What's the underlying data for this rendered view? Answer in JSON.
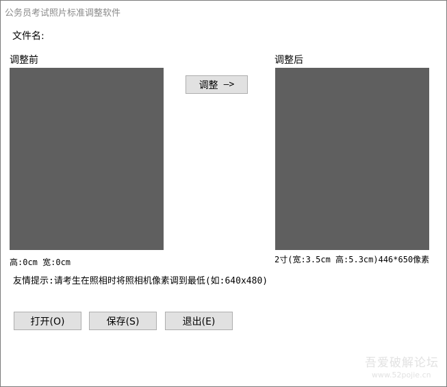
{
  "window": {
    "title": "公务员考试照片标准调整软件"
  },
  "file": {
    "label": "文件名:"
  },
  "before": {
    "label": "调整前",
    "dimensions": "高:0cm  宽:0cm"
  },
  "after": {
    "label": "调整后",
    "dimensions": "2寸(宽:3.5cm 高:5.3cm)446*650像素"
  },
  "adjust_button": {
    "label": "调整",
    "arrow": "—>"
  },
  "tip": {
    "text": "友情提示:请考生在照相时将照相机像素调到最低(如:640x480)"
  },
  "buttons": {
    "open": "打开(O)",
    "save": "保存(S)",
    "exit": "退出(E)"
  },
  "watermark": {
    "line1": "吾爱破解论坛",
    "line2": "www.52pojie.cn"
  },
  "colors": {
    "panel": "#5f5f5f",
    "button_bg": "#e1e1e1",
    "title_text": "#8a8a8a"
  }
}
